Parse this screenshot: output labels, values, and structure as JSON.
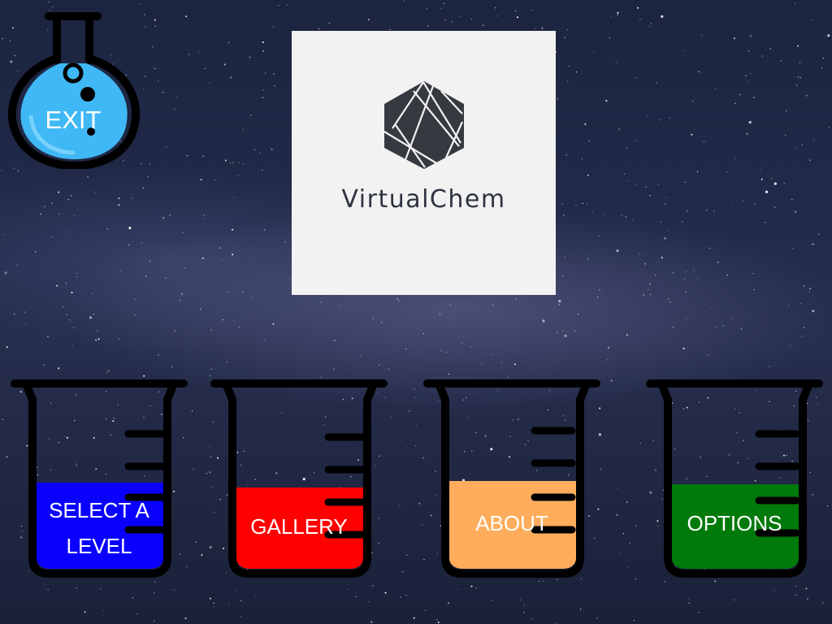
{
  "app": {
    "brand": "VirtualChem"
  },
  "exit_button": {
    "label": "EXIT",
    "liquid_color": "#3fb8f5",
    "icon": "round-bottom-flask-icon"
  },
  "logo": {
    "text": "VirtualChem",
    "icon": "hexagon-logo-icon",
    "card_color": "#f2f2f2",
    "mark_color": "#363a40"
  },
  "menu": [
    {
      "label_lines": [
        "SELECT A",
        "LEVEL"
      ],
      "liquid_color": "#0a00ff",
      "icon": "beaker-icon"
    },
    {
      "label_lines": [
        "GALLERY"
      ],
      "liquid_color": "#ff0000",
      "icon": "beaker-icon"
    },
    {
      "label_lines": [
        "ABOUT"
      ],
      "liquid_color": "#ffad5c",
      "icon": "beaker-icon"
    },
    {
      "label_lines": [
        "OPTIONS"
      ],
      "liquid_color": "#007a0a",
      "icon": "beaker-icon"
    }
  ]
}
